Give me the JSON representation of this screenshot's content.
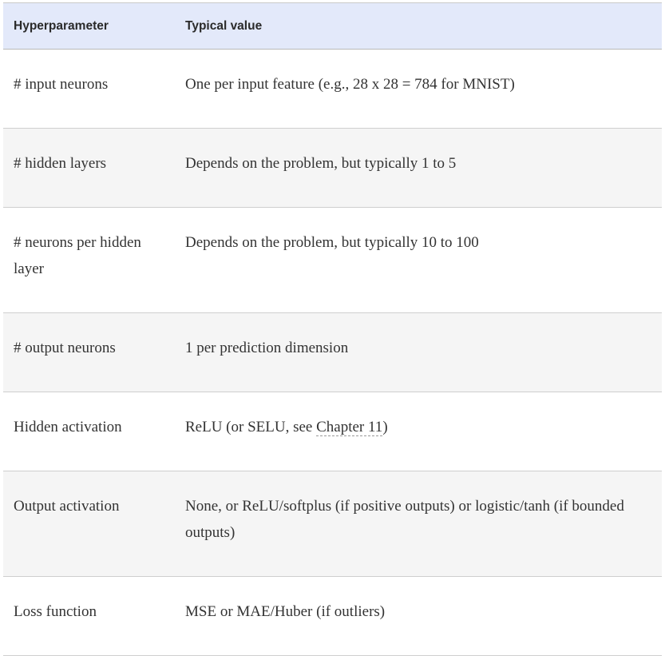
{
  "table": {
    "headers": [
      "Hyperparameter",
      "Typical value"
    ],
    "rows": [
      {
        "param": "# input neurons",
        "value": "One per input feature (e.g., 28 x 28 = 784 for MNIST)"
      },
      {
        "param": "# hidden layers",
        "value": "Depends on the problem, but typically 1 to 5"
      },
      {
        "param": "# neurons per hidden layer",
        "value": "Depends on the problem, but typically 10 to 100"
      },
      {
        "param": "# output neurons",
        "value": "1 per prediction dimension"
      },
      {
        "param": "Hidden activation",
        "value_before": "ReLU (or SELU, see ",
        "value_link": "Chapter 11",
        "value_after": ")"
      },
      {
        "param": "Output activation",
        "value": "None, or ReLU/softplus (if positive outputs) or logistic/tanh (if bounded outputs)"
      },
      {
        "param": "Loss function",
        "value": "MSE or MAE/Huber (if outliers)"
      }
    ]
  }
}
